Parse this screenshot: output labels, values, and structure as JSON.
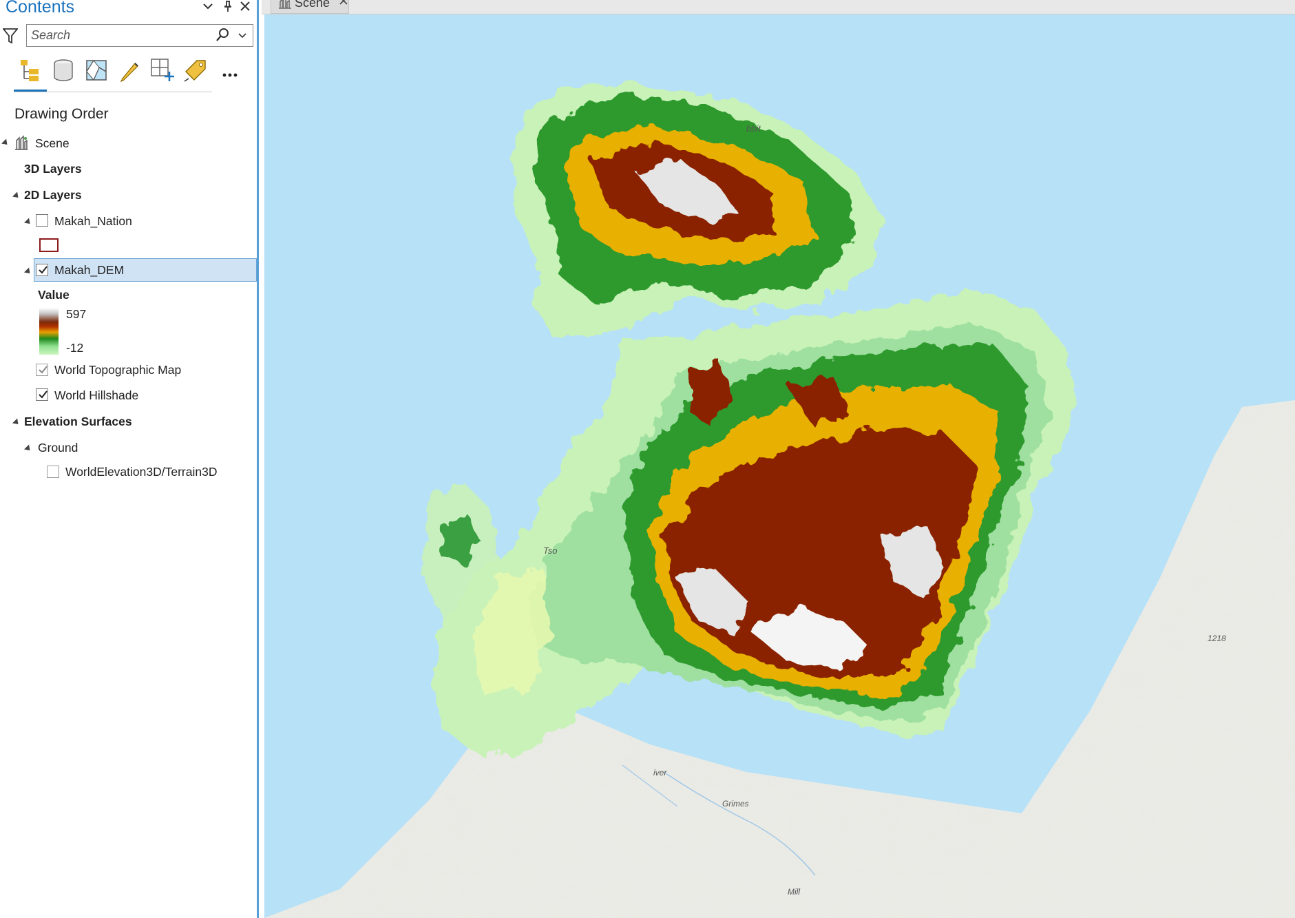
{
  "pane": {
    "title": "Contents",
    "search_placeholder": "Search",
    "section_heading": "Drawing Order"
  },
  "tree": {
    "scene": "Scene",
    "layers_3d": "3D Layers",
    "layers_2d": "2D Layers",
    "makah_nation": "Makah_Nation",
    "makah_dem": "Makah_DEM",
    "value_label": "Value",
    "value_max": "597",
    "value_min": "-12",
    "world_topo": "World Topographic Map",
    "world_hillshade": "World Hillshade",
    "elevation_surfaces": "Elevation Surfaces",
    "ground": "Ground",
    "terrain": "WorldElevation3D/Terrain3D"
  },
  "checked": {
    "makah_nation": false,
    "makah_dem": true,
    "world_topo": true,
    "world_hillshade": true,
    "terrain": false
  },
  "view_tab": {
    "label": "Scene"
  },
  "map": {
    "labels": [
      "bbit",
      "Tso",
      "iver",
      "Grimes",
      "Mill",
      "1218"
    ]
  },
  "colors": {
    "accent": "#1a73bd",
    "selection": "#cfe3f5",
    "water": "#b6e1f7"
  }
}
